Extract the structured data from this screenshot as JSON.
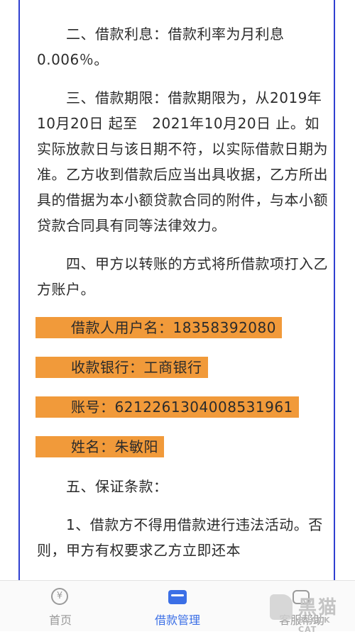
{
  "document": {
    "para2": "　　二、借款利息：借款利率为月利息0.006％。",
    "para3": "　　三、借款期限：借款期限为，从2019年10月20日 起至　2021年10月20日 止。如实际放款日与该日期不符，以实际借款日期为准。乙方收到借款后应当出具收据，乙方所出具的借据为本小额贷款合同的附件，与本小额贷款合同具有同等法律效力。",
    "para4": "　　四、甲方以转账的方式将所借款项打入乙方账户。",
    "highlight_username": "借款人用户名：18358392080",
    "highlight_bank": "收款银行：工商银行",
    "highlight_account": "账号：6212261304008531961",
    "highlight_name": "姓名：朱敏阳",
    "para5": "　　五、保证条款：",
    "para5_1": "　　1、借款方不得用借款进行违法活动。否则，甲方有权要求乙方立即还本"
  },
  "tabbar": {
    "home_label": "首页",
    "loan_label": "借款管理",
    "service_label": "客服帮助",
    "home_icon_glyph": "¥",
    "active_color": "#3b6fe6",
    "inactive_color": "#999999"
  },
  "watermark": {
    "cn": "黑猫",
    "en": "BLACK CAT"
  },
  "colors": {
    "highlight": "#f19a3a",
    "border": "#2f3fd0"
  }
}
